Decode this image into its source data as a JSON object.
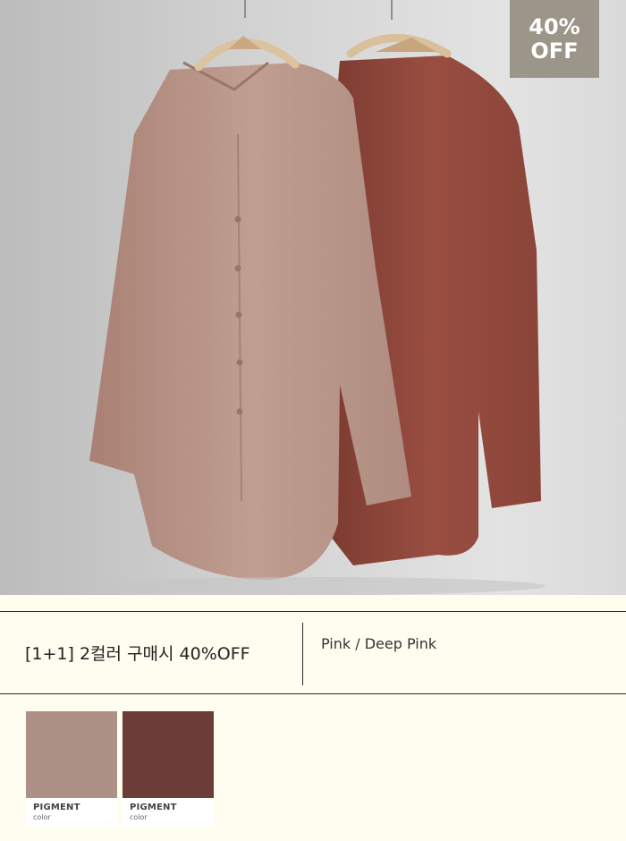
{
  "badge": {
    "line1": "40%",
    "line2": "OFF"
  },
  "product": {
    "title": "[1+1] 2컬러 구매시 40%OFF",
    "colors": "Pink / Deep Pink"
  },
  "swatches": [
    {
      "brand": "PIGMENT",
      "sub": "color",
      "color": "#ad9187"
    },
    {
      "brand": "PIGMENT",
      "sub": "color",
      "color": "#6c3c36"
    }
  ]
}
